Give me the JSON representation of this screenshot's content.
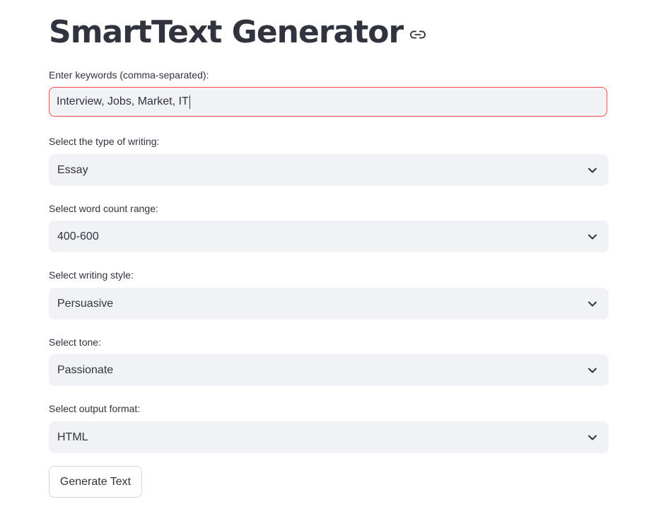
{
  "header": {
    "title": "SmartText Generator",
    "link_icon": "link-icon"
  },
  "keywords": {
    "label": "Enter keywords (comma-separated):",
    "value": "Interview, Jobs, Market, IT"
  },
  "writing_type": {
    "label": "Select the type of writing:",
    "value": "Essay"
  },
  "word_count": {
    "label": "Select word count range:",
    "value": "400-600"
  },
  "writing_style": {
    "label": "Select writing style:",
    "value": "Persuasive"
  },
  "tone": {
    "label": "Select tone:",
    "value": "Passionate"
  },
  "output_format": {
    "label": "Select output format:",
    "value": "HTML"
  },
  "actions": {
    "generate_label": "Generate Text"
  },
  "colors": {
    "text": "#31333f",
    "input_bg": "#f0f2f6",
    "focus_border": "#ff4b4b"
  }
}
